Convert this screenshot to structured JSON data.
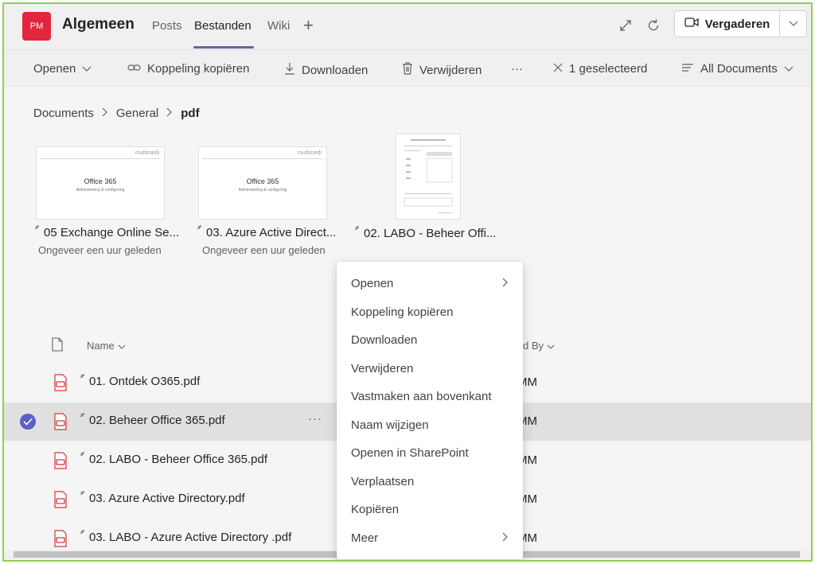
{
  "header": {
    "avatar_initials": "PM",
    "channel_name": "Algemeen",
    "tabs": [
      {
        "label": "Posts"
      },
      {
        "label": "Bestanden"
      },
      {
        "label": "Wiki"
      }
    ],
    "add_tab": "+",
    "meet_button": "Vergaderen"
  },
  "toolbar": {
    "open": "Openen",
    "copy_link": "Koppeling kopiëren",
    "download": "Downloaden",
    "delete": "Verwijderen",
    "more": "···",
    "selected_count": "1 geselecteerd",
    "view": "All Documents"
  },
  "breadcrumb": [
    "Documents",
    "General",
    "pdf"
  ],
  "tiles": [
    {
      "name": "05 Exchange Online Se...",
      "time": "Ongeveer een uur geleden",
      "thumb_title": "Office 365",
      "thumb_sub": "Administering & configuring",
      "brand": "multimedi"
    },
    {
      "name": "03. Azure Active Direct...",
      "time": "Ongeveer een uur geleden",
      "thumb_title": "Office 365",
      "thumb_sub": "Administering & configuring",
      "brand": "multimedi"
    },
    {
      "name": "02. LABO - Beheer Offi...",
      "time": ""
    }
  ],
  "list": {
    "col_name": "Name",
    "col_modified": "d By",
    "rows": [
      {
        "name": "01. Ontdek O365.pdf",
        "modified_by": "MM"
      },
      {
        "name": "02. Beheer Office 365.pdf",
        "modified_by": "MM",
        "selected": true
      },
      {
        "name": "02. LABO - Beheer Office 365.pdf",
        "modified_by": "MM"
      },
      {
        "name": "03. Azure Active Directory.pdf",
        "modified_by": "MM"
      },
      {
        "name": "03. LABO - Azure Active Directory .pdf",
        "modified_by": "MM"
      }
    ],
    "row_more": "···"
  },
  "context_menu": [
    {
      "label": "Openen",
      "submenu": true
    },
    {
      "label": "Koppeling kopiëren"
    },
    {
      "label": "Downloaden"
    },
    {
      "label": "Verwijderen"
    },
    {
      "label": "Vastmaken aan bovenkant"
    },
    {
      "label": "Naam wijzigen"
    },
    {
      "label": "Openen in SharePoint"
    },
    {
      "label": "Verplaatsen"
    },
    {
      "label": "Kopiëren"
    },
    {
      "label": "Meer",
      "submenu": true
    }
  ],
  "colors": {
    "accent": "#6264a7",
    "avatar": "#e2263e",
    "pdf_red": "#d13438",
    "frame_border": "#8fd14f"
  }
}
